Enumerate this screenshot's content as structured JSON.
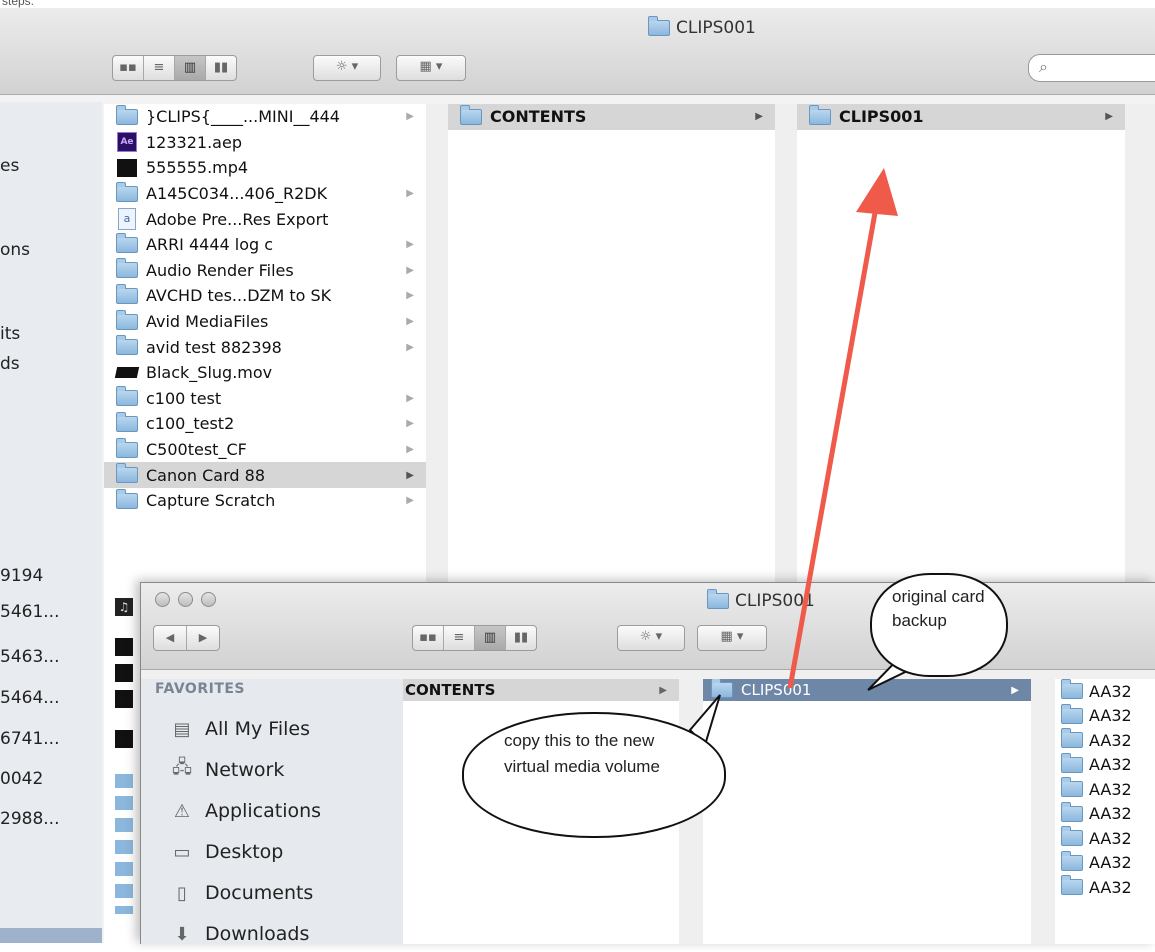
{
  "caption_fragment": "steps.",
  "back_window": {
    "title": "CLIPS001",
    "sidebar_fragments": [
      "es",
      "ons",
      "its",
      "ds"
    ],
    "list_fragments": [
      "9194",
      "5461...",
      "5463...",
      "5464...",
      "6741...",
      "0042",
      "2988..."
    ],
    "toolbar": {
      "view_icons": [
        "icon-view-icon",
        "list-view-icon",
        "column-view-icon",
        "coverflow-view-icon"
      ],
      "action_label": "☼ ▾",
      "arrange_label": "▦ ▾",
      "search_placeholder": ""
    },
    "column1": [
      {
        "icon": "folder",
        "label": "}CLIPS{____...MINI__444",
        "arrow": true
      },
      {
        "icon": "ae-file",
        "label": "123321.aep",
        "arrow": false
      },
      {
        "icon": "video-file",
        "label": "555555.mp4",
        "arrow": false
      },
      {
        "icon": "folder",
        "label": "A145C034...406_R2DK",
        "arrow": true
      },
      {
        "icon": "text-file",
        "label": "Adobe Pre...Res Export",
        "arrow": false
      },
      {
        "icon": "folder",
        "label": "ARRI 4444 log c",
        "arrow": true
      },
      {
        "icon": "folder",
        "label": "Audio Render Files",
        "arrow": true
      },
      {
        "icon": "folder",
        "label": "AVCHD tes...DZM to SK",
        "arrow": true
      },
      {
        "icon": "folder",
        "label": "Avid MediaFiles",
        "arrow": true
      },
      {
        "icon": "folder",
        "label": "avid test 882398",
        "arrow": true
      },
      {
        "icon": "slug-file",
        "label": "Black_Slug.mov",
        "arrow": false
      },
      {
        "icon": "folder",
        "label": "c100 test",
        "arrow": true
      },
      {
        "icon": "folder",
        "label": "c100_test2",
        "arrow": true
      },
      {
        "icon": "folder",
        "label": "C500test_CF",
        "arrow": true
      },
      {
        "icon": "folder",
        "label": "Canon Card 88",
        "arrow": true,
        "selected": true
      },
      {
        "icon": "folder",
        "label": "Capture Scratch",
        "arrow": true
      }
    ],
    "column2": [
      {
        "label": "CONTENTS"
      }
    ],
    "column3": [
      {
        "label": "CLIPS001"
      }
    ]
  },
  "front_window": {
    "title": "CLIPS001",
    "nav_back": "◀",
    "nav_forward": "▶",
    "favorites_heading": "FAVORITES",
    "favorites": [
      {
        "icon": "all-files-icon",
        "glyph": "▤",
        "label": "All My Files"
      },
      {
        "icon": "network-icon",
        "glyph": "🖧",
        "label": "Network"
      },
      {
        "icon": "applications-icon",
        "glyph": "⚠",
        "label": "Applications"
      },
      {
        "icon": "desktop-icon",
        "glyph": "▭",
        "label": "Desktop"
      },
      {
        "icon": "documents-icon",
        "glyph": "▯",
        "label": "Documents"
      },
      {
        "icon": "downloads-icon",
        "glyph": "⬇",
        "label": "Downloads"
      }
    ],
    "column1_label": "CONTENTS",
    "column2_label": "CLIPS001",
    "column3_items": [
      "AA32",
      "AA32",
      "AA32",
      "AA32",
      "AA32",
      "AA32",
      "AA32",
      "AA32",
      "AA32"
    ]
  },
  "annotations": {
    "bubble1": "original card backup",
    "bubble2": "copy this to the new virtual media volume",
    "arrow_color": "#f05a4a"
  },
  "colors": {
    "selection_gray": "#d6d6d6",
    "selection_blue": "#6f87a6",
    "sidebar_bg": "#e6e9ee"
  }
}
